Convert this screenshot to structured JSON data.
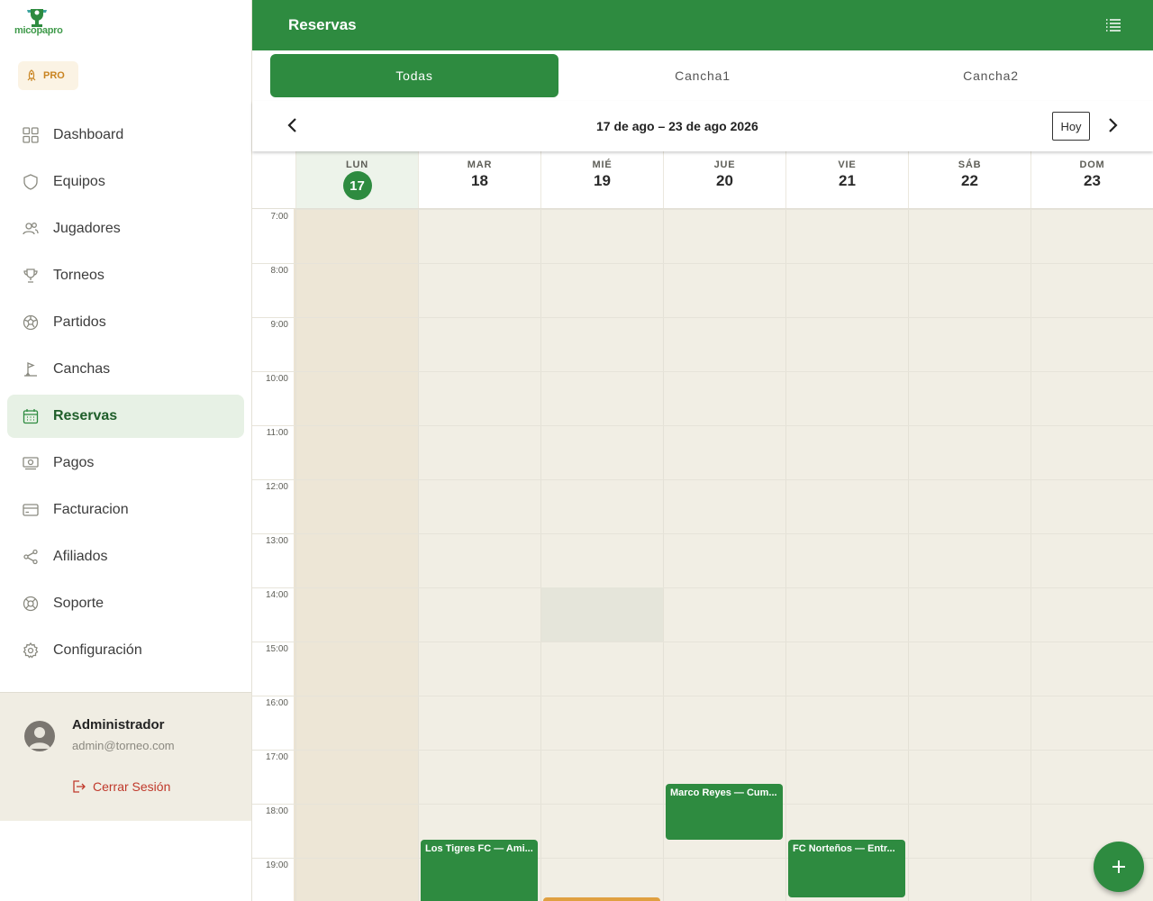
{
  "brand": {
    "logo_text": "micopapro",
    "plan_badge": "PRO"
  },
  "sidebar": {
    "items": [
      {
        "label": "Dashboard",
        "icon": "dashboard-icon",
        "active": false
      },
      {
        "label": "Equipos",
        "icon": "shield-icon",
        "active": false
      },
      {
        "label": "Jugadores",
        "icon": "people-icon",
        "active": false
      },
      {
        "label": "Torneos",
        "icon": "trophy-icon",
        "active": false
      },
      {
        "label": "Partidos",
        "icon": "soccer-ball-icon",
        "active": false
      },
      {
        "label": "Canchas",
        "icon": "field-flag-icon",
        "active": false
      },
      {
        "label": "Reservas",
        "icon": "calendar-icon",
        "active": true
      },
      {
        "label": "Pagos",
        "icon": "money-icon",
        "active": false
      },
      {
        "label": "Facturacion",
        "icon": "credit-card-icon",
        "active": false
      },
      {
        "label": "Afiliados",
        "icon": "share-icon",
        "active": false
      },
      {
        "label": "Soporte",
        "icon": "lifebuoy-icon",
        "active": false
      },
      {
        "label": "Configuración",
        "icon": "gear-icon",
        "active": false
      }
    ]
  },
  "user": {
    "name": "Administrador",
    "email": "admin@torneo.com",
    "logout_label": "Cerrar Sesión"
  },
  "header": {
    "title": "Reservas"
  },
  "tabs": [
    {
      "label": "Todas",
      "active": true
    },
    {
      "label": "Cancha1",
      "active": false
    },
    {
      "label": "Cancha2",
      "active": false
    }
  ],
  "datebar": {
    "range": "17 de ago – 23 de ago 2026",
    "today_label": "Hoy"
  },
  "calendar": {
    "days": [
      {
        "name": "LUN",
        "num": "17",
        "today": true
      },
      {
        "name": "MAR",
        "num": "18",
        "today": false
      },
      {
        "name": "MIÉ",
        "num": "19",
        "today": false
      },
      {
        "name": "JUE",
        "num": "20",
        "today": false
      },
      {
        "name": "VIE",
        "num": "21",
        "today": false
      },
      {
        "name": "SÁB",
        "num": "22",
        "today": false
      },
      {
        "name": "DOM",
        "num": "23",
        "today": false
      }
    ],
    "hours": [
      "7:00",
      "8:00",
      "9:00",
      "10:00",
      "11:00",
      "12:00",
      "13:00",
      "14:00",
      "15:00",
      "16:00",
      "17:00",
      "18:00",
      "19:00"
    ],
    "events": [
      {
        "title": "Marco Reyes — Cum...",
        "day": 3,
        "start": 17.63,
        "end": 18.67,
        "color": "#2e8b40"
      },
      {
        "title": "Los Tigres FC — Ami...",
        "day": 1,
        "start": 18.67,
        "end": 20.0,
        "color": "#2e8b40"
      },
      {
        "title": "FC Norteños — Entr...",
        "day": 4,
        "start": 18.67,
        "end": 19.73,
        "color": "#2e8b40"
      },
      {
        "title": "",
        "day": 2,
        "start": 19.73,
        "end": 20.5,
        "color": "#e0a040"
      }
    ],
    "hover_cell": {
      "day": 2,
      "hour": 14
    }
  }
}
